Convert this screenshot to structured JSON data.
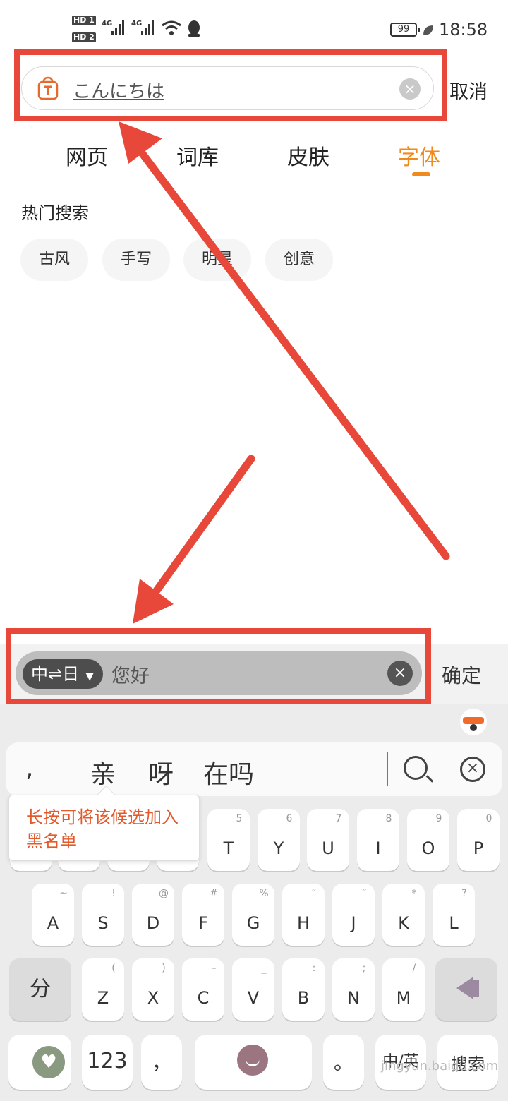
{
  "status": {
    "hd1": "HD 1",
    "hd2": "HD 2",
    "net1": "4G",
    "net2": "4G",
    "battery": "99",
    "time": "18:58"
  },
  "search": {
    "query": "こんにちは",
    "cancel_label": "取消"
  },
  "tabs": [
    {
      "label": "网页"
    },
    {
      "label": "词库"
    },
    {
      "label": "皮肤"
    },
    {
      "label": "字体",
      "active": true
    }
  ],
  "hot": {
    "title": "热门搜索",
    "chips": [
      "古风",
      "手写",
      "明星",
      "创意"
    ]
  },
  "translate": {
    "lang_pair": "中⇌日",
    "text": "您好",
    "confirm_label": "确定"
  },
  "candidates": [
    ",",
    "亲",
    "呀",
    "在吗"
  ],
  "tooltip": "长按可将该候选加入黑名单",
  "keyboard": {
    "row1": [
      {
        "main": "T",
        "sub": "5"
      },
      {
        "main": "Y",
        "sub": "6"
      },
      {
        "main": "U",
        "sub": "7"
      },
      {
        "main": "I",
        "sub": "8"
      },
      {
        "main": "O",
        "sub": "9"
      },
      {
        "main": "P",
        "sub": "0"
      }
    ],
    "row2": [
      {
        "main": "A",
        "sub": "~"
      },
      {
        "main": "S",
        "sub": "!"
      },
      {
        "main": "D",
        "sub": "@"
      },
      {
        "main": "F",
        "sub": "#"
      },
      {
        "main": "G",
        "sub": "%"
      },
      {
        "main": "H",
        "sub": "“"
      },
      {
        "main": "J",
        "sub": "”"
      },
      {
        "main": "K",
        "sub": "*"
      },
      {
        "main": "L",
        "sub": "?"
      }
    ],
    "row3": [
      {
        "main": "Z",
        "sub": "("
      },
      {
        "main": "X",
        "sub": ")"
      },
      {
        "main": "C",
        "sub": "–"
      },
      {
        "main": "V",
        "sub": "_"
      },
      {
        "main": "B",
        "sub": ":"
      },
      {
        "main": "N",
        "sub": ";"
      },
      {
        "main": "M",
        "sub": "/"
      }
    ],
    "split_label": "分",
    "num_label": "123",
    "comma_label": "，",
    "period_label": "。",
    "lang_label": "中/英",
    "search_label": "搜索"
  },
  "watermark": "jingyan.baidu.com",
  "colors": {
    "accent": "#f08a1c",
    "annotation": "#e8483a"
  }
}
